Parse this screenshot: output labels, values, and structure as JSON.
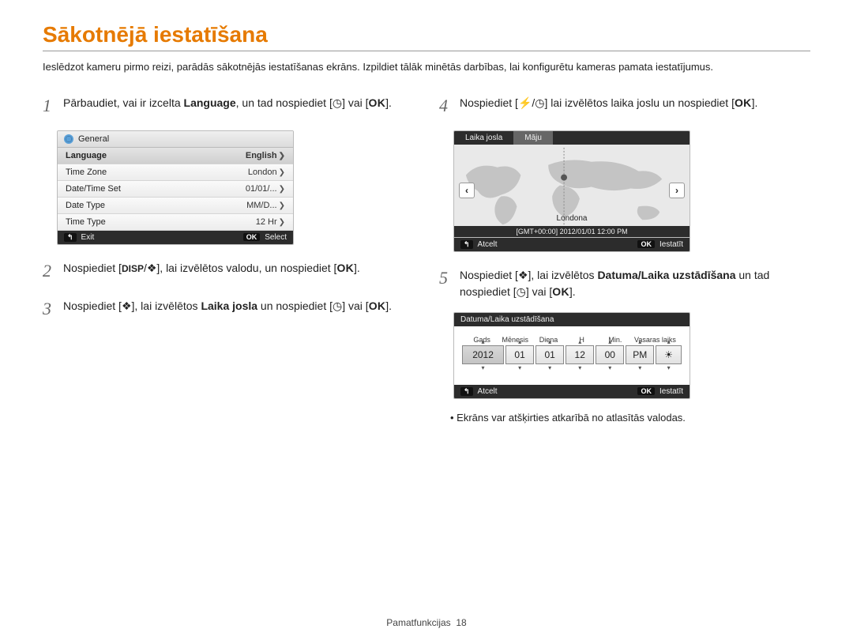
{
  "title": "Sākotnējā iestatīšana",
  "intro": "Ieslēdzot kameru pirmo reizi, parādās sākotnējās iestatīšanas ekrāns. Izpildiet tālāk minētās darbības, lai konfigurētu kameras pamata iestatījumus.",
  "steps": {
    "s1a": "Pārbaudiet, vai ir izcelta ",
    "s1b": "Language",
    "s1c": ", un tad nospiediet [",
    "s1d": "] vai [",
    "s1e": "].",
    "s2a": "Nospiediet [",
    "s2b": "], lai izvēlētos valodu, un nospiediet [",
    "s2c": "].",
    "s3a": "Nospiediet [",
    "s3b": "], lai izvēlētos ",
    "s3c": "Laika josla",
    "s3d": " un nospiediet [",
    "s3e": "] vai [",
    "s3f": "].",
    "s4a": "Nospiediet [",
    "s4b": "] lai izvēlētos laika joslu un nospiediet [",
    "s4c": "].",
    "s5a": "Nospiediet [",
    "s5b": "], lai izvēlētos ",
    "s5c": "Datuma/Laika uzstādīšana",
    "s5d": " un tad nospiediet [",
    "s5e": "] vai [",
    "s5f": "]."
  },
  "glyphs": {
    "timer": "◷",
    "ok": "OK",
    "disp": "DISP",
    "macro": "❖",
    "flash": "⚡",
    "slash": "/",
    "lbr": "[",
    "rbr": "]"
  },
  "menu": {
    "header": "General",
    "rows": [
      {
        "label": "Language",
        "value": "English",
        "chev": true,
        "hl": true
      },
      {
        "label": "Time Zone",
        "value": "London",
        "chev": true
      },
      {
        "label": "Date/Time Set",
        "value": "01/01/...",
        "chev": true
      },
      {
        "label": "Date Type",
        "value": "MM/D...",
        "chev": true
      },
      {
        "label": "Time Type",
        "value": "12 Hr",
        "chev": true
      }
    ],
    "exit": "Exit",
    "select": "Select",
    "back_icon": "↰",
    "ok_icon": "OK"
  },
  "timezone": {
    "tab1": "Laika josla",
    "tab2": "Māju",
    "location": "Londona",
    "gmt": "[GMT+00:00]  2012/01/01   12:00 PM",
    "cancel": "Atcelt",
    "set": "Iestatīt"
  },
  "datetime": {
    "title": "Datuma/Laika uzstādīšana",
    "labels": {
      "year": "Gads",
      "month": "Mēnesis",
      "day": "Diena",
      "h": "H",
      "min": "Min.",
      "dst": "Vasaras laiks"
    },
    "values": {
      "year": "2012",
      "month": "01",
      "day": "01",
      "h": "12",
      "min": "00",
      "ampm": "PM",
      "dst": "☀"
    },
    "cancel": "Atcelt",
    "set": "Iestatīt"
  },
  "note": "Ekrāns var atšķirties atkarībā no atlasītās valodas.",
  "footer": {
    "section": "Pamatfunkcijas",
    "page": "18"
  }
}
